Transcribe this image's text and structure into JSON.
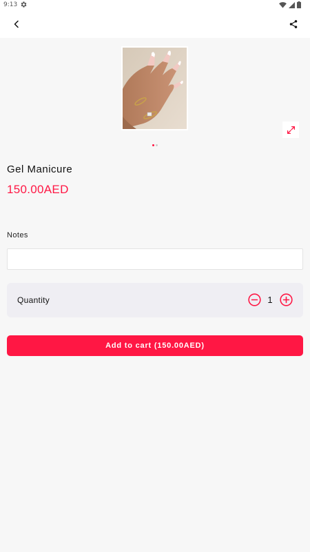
{
  "status_bar": {
    "time": "9:13",
    "icons": [
      "settings-gear-icon",
      "wifi-icon",
      "signal-icon",
      "battery-icon"
    ]
  },
  "app_bar": {
    "icons": [
      "back-arrow-icon",
      "share-icon"
    ]
  },
  "gallery": {
    "image": "manicured-nails-photo",
    "expand_icon": "expand-arrows-icon",
    "page_count": 2,
    "active_page": 1
  },
  "product": {
    "title": "Gel Manicure",
    "price": "150.00AED"
  },
  "notes": {
    "label": "Notes",
    "value": "",
    "placeholder": ""
  },
  "quantity": {
    "label": "Quantity",
    "value": "1",
    "icons": [
      "minus-circle-icon",
      "plus-circle-icon"
    ]
  },
  "cart": {
    "button_label": "Add to cart (150.00AED)"
  },
  "colors": {
    "accent": "#ff1744",
    "background": "#f7f7f7",
    "card": "#efeef3"
  }
}
